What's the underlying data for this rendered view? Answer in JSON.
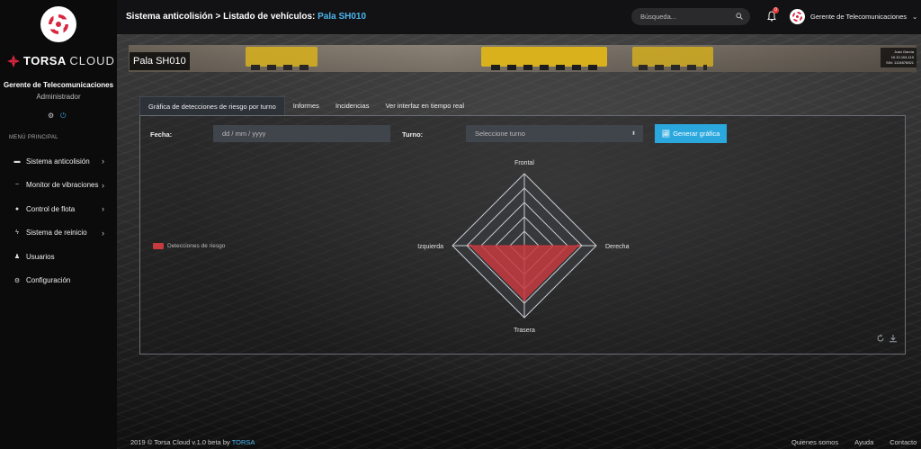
{
  "sidebar": {
    "brand_bold": "TORSA",
    "brand_light": "CLOUD",
    "user_name": "Gerente de Telecomunicaciones",
    "user_role": "Administrador",
    "menu_title": "MENÚ PRINCIPAL",
    "items": [
      {
        "label": "Sistema anticolisión",
        "icon": "truck-icon",
        "has_submenu": true
      },
      {
        "label": "Monitor de vibraciones",
        "icon": "wave-icon",
        "has_submenu": true
      },
      {
        "label": "Control de flota",
        "icon": "map-pin-icon",
        "has_submenu": true
      },
      {
        "label": "Sistema de reinicio",
        "icon": "bolt-icon",
        "has_submenu": true
      },
      {
        "label": "Usuarios",
        "icon": "user-icon",
        "has_submenu": false
      },
      {
        "label": "Configuración",
        "icon": "gear-icon",
        "has_submenu": false
      }
    ]
  },
  "header": {
    "breadcrumb_prefix": "Sistema anticolisión > Listado de vehículos:",
    "breadcrumb_current": "Pala SH010",
    "search_placeholder": "Búsqueda...",
    "notification_count": "0",
    "user_menu_label": "Gerente de Telecomunicaciones"
  },
  "banner": {
    "title": "Pala SH010",
    "info_lines": [
      "Juan García",
      "10.10.104.110",
      "S/N: 1124578921"
    ]
  },
  "tabs": [
    {
      "label": "Gráfica de detecciones de riesgo por turno",
      "active": true
    },
    {
      "label": "Informes",
      "active": false
    },
    {
      "label": "Incidencias",
      "active": false
    },
    {
      "label": "Ver interfaz en tiempo real",
      "active": false
    }
  ],
  "form": {
    "date_label": "Fecha:",
    "date_placeholder": "dd / mm / yyyy",
    "shift_label": "Turno:",
    "shift_selected": "Seleccione turno",
    "generate_button": "Generar gráfica"
  },
  "chart_data": {
    "type": "radar",
    "title": "",
    "axes": [
      "Frontal",
      "Derecha",
      "Trasera",
      "Izquierda"
    ],
    "series": [
      {
        "name": "Detecciones de riesgo",
        "color": "#c63a40",
        "values": [
          0,
          0.75,
          0.75,
          0.75
        ]
      }
    ],
    "rlim": [
      0,
      1
    ],
    "rings": 5,
    "legend_position": "left"
  },
  "footer": {
    "copyright_prefix": "2019 © Torsa Cloud v.1.0 beta by",
    "copyright_brand": "TORSA",
    "links": [
      "Quienes somos",
      "Ayuda",
      "Contacto"
    ]
  },
  "colors": {
    "accent": "#2aa8de",
    "link": "#4db5ee",
    "series": "#c63a40",
    "badge": "#e03b3b"
  }
}
